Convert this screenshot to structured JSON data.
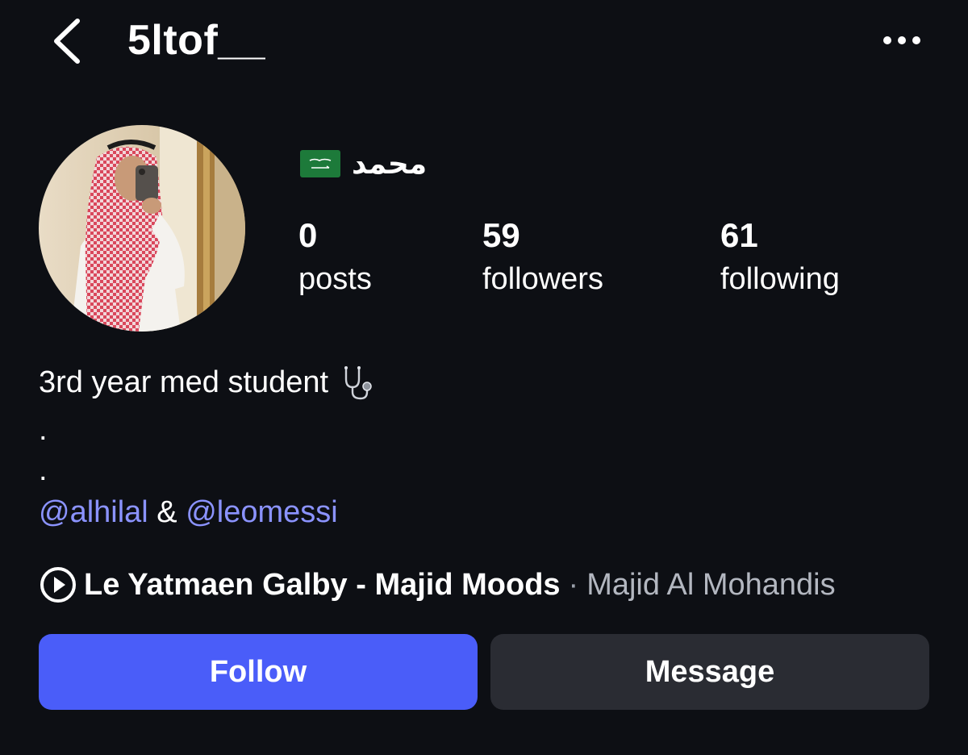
{
  "header": {
    "username": "5ltof__",
    "back_icon": "chevron-left-icon",
    "more_icon": "more-horizontal-icon"
  },
  "profile": {
    "display_name": "محمد",
    "flag_icon": "saudi-flag-icon",
    "stats": [
      {
        "value": "0",
        "label": "posts"
      },
      {
        "value": "59",
        "label": "followers"
      },
      {
        "value": "61",
        "label": "following"
      }
    ]
  },
  "bio": {
    "line1": "3rd year med student",
    "line1_icon": "stethoscope-icon",
    "dot1": ".",
    "dot2": ".",
    "mention1": "@alhilal",
    "joiner": " & ",
    "mention2": "@leomessi"
  },
  "music": {
    "icon": "play-circle-icon",
    "song": "Le Yatmaen Galby - Majid Moods",
    "separator": "·",
    "artist": "Majid Al Mohandis"
  },
  "actions": {
    "follow_label": "Follow",
    "message_label": "Message"
  },
  "colors": {
    "background": "#0d0f14",
    "accent": "#4a5df9",
    "mention": "#8b93ff",
    "secondary_button": "#2a2c33"
  }
}
